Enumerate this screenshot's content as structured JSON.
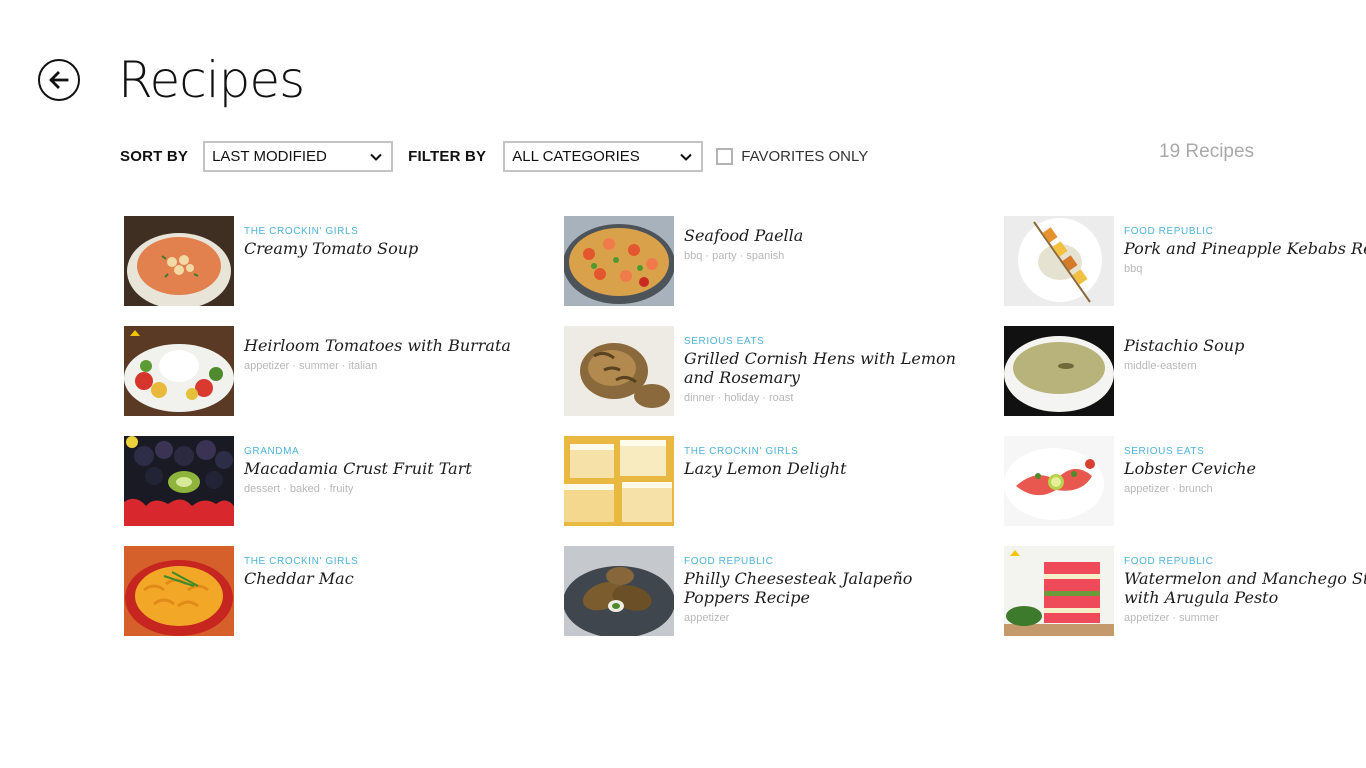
{
  "header": {
    "title": "Recipes",
    "back_icon": "back-arrow-icon"
  },
  "toolbar": {
    "sort_label": "SORT BY",
    "sort_value": "LAST MODIFIED",
    "filter_label": "FILTER BY",
    "filter_value": "ALL CATEGORIES",
    "favorites_label": "FAVORITES ONLY",
    "favorites_checked": false
  },
  "count": "19 Recipes",
  "colors": {
    "accent": "#4fb3d6",
    "tags": "#b8b8b8",
    "count": "#a9a9a9"
  },
  "recipes": [
    {
      "source": "THE CROCKIN' GIRLS",
      "title": "Creamy Tomato Soup",
      "tags": "",
      "image": "tomato-soup"
    },
    {
      "source": "",
      "title": "Heirloom Tomatoes with Burrata",
      "tags": "appetizer · summer · italian",
      "image": "burrata-salad"
    },
    {
      "source": "GRANDMA",
      "title": "Macadamia Crust Fruit Tart",
      "tags": "dessert · baked · fruity",
      "image": "fruit-tart"
    },
    {
      "source": "THE CROCKIN' GIRLS",
      "title": "Cheddar Mac",
      "tags": "",
      "image": "mac-and-cheese"
    },
    {
      "source": "",
      "title": "Seafood Paella",
      "tags": "bbq · party · spanish",
      "image": "paella"
    },
    {
      "source": "SERIOUS EATS",
      "title": "Grilled Cornish Hens with Lemon\nand Rosemary",
      "tags": "dinner · holiday · roast",
      "image": "roast-hens"
    },
    {
      "source": "THE CROCKIN' GIRLS",
      "title": "Lazy Lemon Delight",
      "tags": "",
      "image": "lemon-bars"
    },
    {
      "source": "FOOD REPUBLIC",
      "title": "Philly Cheesesteak Jalapeño\nPoppers Recipe",
      "tags": "appetizer",
      "image": "jalapeno-poppers"
    },
    {
      "source": "FOOD REPUBLIC",
      "title": "Pork and Pineapple Kebabs Recipe",
      "tags": "bbq",
      "image": "kebabs"
    },
    {
      "source": "",
      "title": "Pistachio Soup",
      "tags": "middle-eastern",
      "image": "pistachio-soup"
    },
    {
      "source": "SERIOUS EATS",
      "title": "Lobster Ceviche",
      "tags": "appetizer · brunch",
      "image": "ceviche"
    },
    {
      "source": "FOOD REPUBLIC",
      "title": "Watermelon and Manchego Stacks\nwith Arugula Pesto",
      "tags": "appetizer · summer",
      "image": "watermelon-stacks"
    }
  ]
}
